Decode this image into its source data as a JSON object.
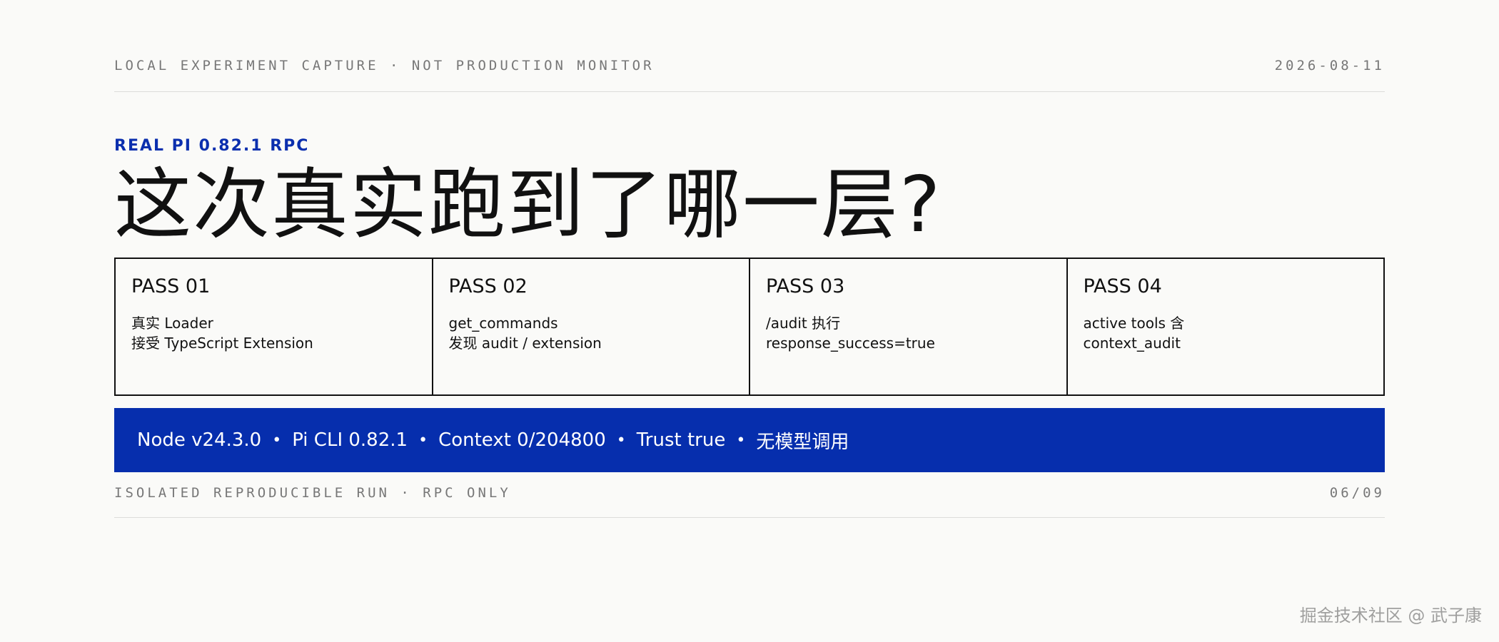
{
  "top_meta": {
    "left": "LOCAL EXPERIMENT CAPTURE · NOT PRODUCTION MONITOR",
    "right": "2026-08-11"
  },
  "eyebrow": "REAL PI 0.82.1 RPC",
  "headline": "这次真实跑到了哪一层?",
  "passes": [
    {
      "title": "PASS 01",
      "line1": "真实 Loader",
      "line2": "接受 TypeScript Extension"
    },
    {
      "title": "PASS 02",
      "line1": "get_commands",
      "line2": "发现 audit / extension"
    },
    {
      "title": "PASS 03",
      "line1": "/audit 执行",
      "line2": "response_success=true"
    },
    {
      "title": "PASS 04",
      "line1": "active tools 含",
      "line2": "context_audit"
    }
  ],
  "env": {
    "node": "Node v24.3.0",
    "cli": "Pi CLI 0.82.1",
    "context": "Context 0/204800",
    "trust": "Trust true",
    "model": "无模型调用",
    "separator": "•"
  },
  "bottom_meta": {
    "left": "ISOLATED REPRODUCIBLE RUN · RPC ONLY",
    "right": "06/09"
  },
  "watermark": "掘金技术社区 @ 武子康",
  "colors": {
    "accent": "#062ead",
    "background": "#fafaf8",
    "text": "#111111",
    "meta": "#777777"
  }
}
